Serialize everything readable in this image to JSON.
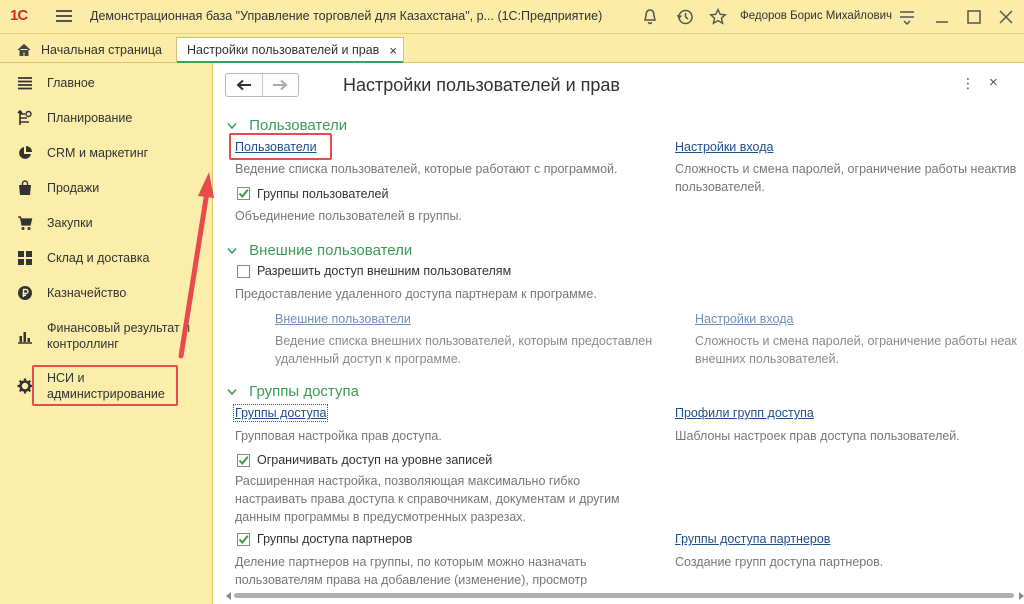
{
  "titlebar": {
    "logo_text": "1С",
    "window_title": "Демонстрационная база \"Управление торговлей для Казахстана\", р...  (1С:Предприятие)",
    "user_name": "Федоров Борис Михайлович"
  },
  "tabs": {
    "home_label": "Начальная страница",
    "active_label": "Настройки пользователей и прав",
    "close_glyph": "×"
  },
  "sidebar": {
    "items": [
      {
        "label": "Главное",
        "icon": "menu-lines-icon"
      },
      {
        "label": "Планирование",
        "icon": "planning-icon"
      },
      {
        "label": "CRM и маркетинг",
        "icon": "pie-chart-icon"
      },
      {
        "label": "Продажи",
        "icon": "bag-icon"
      },
      {
        "label": "Закупки",
        "icon": "cart-icon"
      },
      {
        "label": "Склад и доставка",
        "icon": "warehouse-icon"
      },
      {
        "label": "Казначейство",
        "icon": "ruble-coin-icon"
      },
      {
        "label": "Финансовый результат и контроллинг",
        "icon": "bar-chart-icon"
      },
      {
        "label": "НСИ и администрирование",
        "icon": "gear-icon"
      }
    ]
  },
  "page": {
    "title": "Настройки пользователей и прав",
    "more_glyph": "⋮",
    "close_glyph": "×"
  },
  "sections": {
    "users": {
      "title": "Пользователи",
      "users_link": "Пользователи",
      "users_desc": "Ведение списка пользователей, которые работают с программой.",
      "login_link": "Настройки входа",
      "login_desc": "Сложность и смена паролей, ограничение работы неактив пользователей.",
      "groups_checkbox": "Группы пользователей",
      "groups_checked": true,
      "groups_desc": "Объединение пользователей в группы."
    },
    "external": {
      "title": "Внешние пользователи",
      "allow_checkbox": "Разрешить доступ внешним пользователям",
      "allow_checked": false,
      "allow_desc": "Предоставление удаленного доступа партнерам к программе.",
      "ext_users_link": "Внешние пользователи",
      "ext_users_desc": "Ведение списка внешних пользователей, которым предоставлен удаленный доступ к программе.",
      "ext_login_link": "Настройки входа",
      "ext_login_desc": "Сложность и смена паролей, ограничение работы неак внешних пользователей."
    },
    "access": {
      "title": "Группы доступа",
      "groups_link": "Группы доступа",
      "groups_desc": "Групповая настройка прав доступа.",
      "profiles_link": "Профили групп доступа",
      "profiles_desc": "Шаблоны настроек прав доступа пользователей.",
      "records_checkbox": "Ограничивать доступ на уровне записей",
      "records_checked": true,
      "records_desc": "Расширенная настройка, позволяющая максимально гибко настраивать права доступа к справочникам, документам и другим данным программы в предусмотренных разрезах.",
      "partners_checkbox": "Группы доступа партнеров",
      "partners_checked": true,
      "partners_desc": "Деление партнеров на группы, по которым можно назначать пользователям права на добавление (изменение), просмотр",
      "partners_link": "Группы доступа партнеров",
      "partners_link_desc": "Создание групп доступа партнеров."
    }
  },
  "colors": {
    "accent_green": "#3c9b55",
    "link_blue": "#1f4f8c",
    "highlight_red": "#e74b4b",
    "panel_yellow": "#fbedaa"
  }
}
